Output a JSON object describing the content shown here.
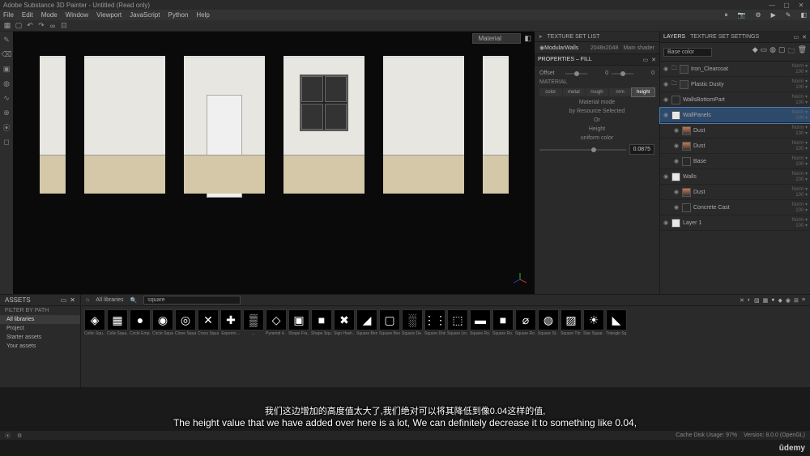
{
  "titlebar": {
    "title": "Adobe Substance 3D Painter - Untitled (Read only)"
  },
  "menu": {
    "items": [
      "File",
      "Edit",
      "Mode",
      "Window",
      "Viewport",
      "JavaScript",
      "Python",
      "Help"
    ]
  },
  "viewport": {
    "mode": "Material"
  },
  "texture_sets": {
    "title": "TEXTURE SET LIST",
    "item": {
      "name": "ModularWalls",
      "res": "2048x2048",
      "shader": "Main shader"
    }
  },
  "properties": {
    "title": "PROPERTIES – FILL",
    "offset": {
      "label": "Offset",
      "x": "0",
      "y": "0"
    },
    "material_label": "MATERIAL",
    "channels": [
      "color",
      "metal",
      "rough",
      "nrm",
      "height"
    ],
    "active_channel": 4,
    "mode_label": "Material mode",
    "mode_value": "by Resource Selected",
    "or": "Or",
    "height_label": "Height",
    "height_mode": "uniform color",
    "height_value": "0.0875"
  },
  "layers": {
    "tabs": [
      "LAYERS",
      "TEXTURE SET SETTINGS"
    ],
    "blend": "Base color",
    "items": [
      {
        "type": "folder",
        "name": "Iron_Clearcoat",
        "opacity": "100",
        "eye": "◉",
        "swatch": "folder"
      },
      {
        "type": "folder",
        "name": "Plastic Dusty",
        "opacity": "100",
        "eye": "◉",
        "swatch": "folder"
      },
      {
        "type": "layer",
        "name": "WallsBottomPart",
        "opacity": "100",
        "eye": "◉",
        "swatch": "swatch-dark"
      },
      {
        "type": "layer",
        "name": "WallPanels",
        "opacity": "100",
        "eye": "◉",
        "swatch": "swatch-white",
        "selected": true
      },
      {
        "type": "layer",
        "name": "Dust",
        "opacity": "100",
        "eye": "◉",
        "swatch": "swatch-orange",
        "child": true
      },
      {
        "type": "layer",
        "name": "Dust",
        "opacity": "100",
        "eye": "◉",
        "swatch": "swatch-orange",
        "child": true
      },
      {
        "type": "layer",
        "name": "Base",
        "opacity": "100",
        "eye": "◉",
        "swatch": "swatch-dark",
        "child": true
      },
      {
        "type": "layer",
        "name": "Walls",
        "opacity": "100",
        "eye": "◉",
        "swatch": "swatch-white"
      },
      {
        "type": "layer",
        "name": "Dust",
        "opacity": "100",
        "eye": "◉",
        "swatch": "swatch-orange",
        "child": true
      },
      {
        "type": "layer",
        "name": "Concrete Cast",
        "opacity": "100",
        "eye": "◉",
        "swatch": "swatch-dark",
        "child": true
      },
      {
        "type": "layer",
        "name": "Layer 1",
        "opacity": "100",
        "eye": "◉",
        "swatch": "swatch-white"
      }
    ]
  },
  "assets": {
    "title": "ASSETS",
    "filter_label": "FILTER BY PATH",
    "filters": [
      "All libraries",
      "Project",
      "Starter assets",
      "Your assets"
    ],
    "libs_label": "All libraries",
    "search": "square",
    "tiles": [
      {
        "glyph": "◈",
        "label": "Celtic Squ…"
      },
      {
        "glyph": "▦",
        "label": "Cells Squa…"
      },
      {
        "glyph": "●",
        "label": "Circle Emp…"
      },
      {
        "glyph": "◉",
        "label": "Circle Squa…"
      },
      {
        "glyph": "◎",
        "label": "Clone Squa…"
      },
      {
        "glyph": "✕",
        "label": "Cross Squa…"
      },
      {
        "glyph": "✚",
        "label": "Experim…"
      },
      {
        "glyph": "▒",
        "label": "…"
      },
      {
        "glyph": "◇",
        "label": "Pyramid 4…"
      },
      {
        "glyph": "▣",
        "label": "Shape Fra…"
      },
      {
        "glyph": "■",
        "label": "Shape Squ…"
      },
      {
        "glyph": "✖",
        "label": "Sign Hash…"
      },
      {
        "glyph": "◢",
        "label": "Square Bend"
      },
      {
        "glyph": "▢",
        "label": "Square Bev…"
      },
      {
        "glyph": "░",
        "label": "Square De…"
      },
      {
        "glyph": "⋮⋮",
        "label": "Square Dots"
      },
      {
        "glyph": "⬚",
        "label": "Square Lin…"
      },
      {
        "glyph": "▬",
        "label": "Square Ro…"
      },
      {
        "glyph": "■",
        "label": "Square Ro…"
      },
      {
        "glyph": "⌀",
        "label": "Square Ro…"
      },
      {
        "glyph": "◍",
        "label": "Square St…"
      },
      {
        "glyph": "▨",
        "label": "Square Thr…"
      },
      {
        "glyph": "☀",
        "label": "Star Squar…"
      },
      {
        "glyph": "◣",
        "label": "Triangle Sq…"
      }
    ]
  },
  "status": {
    "cache": "Cache Disk Usage: 97%",
    "version": "Version: 8.0.0 (OpenGL)"
  },
  "subtitle": {
    "cn": "我们这边增加的高度值太大了,我们绝对可以将其降低到像0.04这样的值,",
    "en": "The height value that we have added over here is a lot, We can definitely decrease it to something like 0.04,"
  },
  "brand": "ûdemy"
}
